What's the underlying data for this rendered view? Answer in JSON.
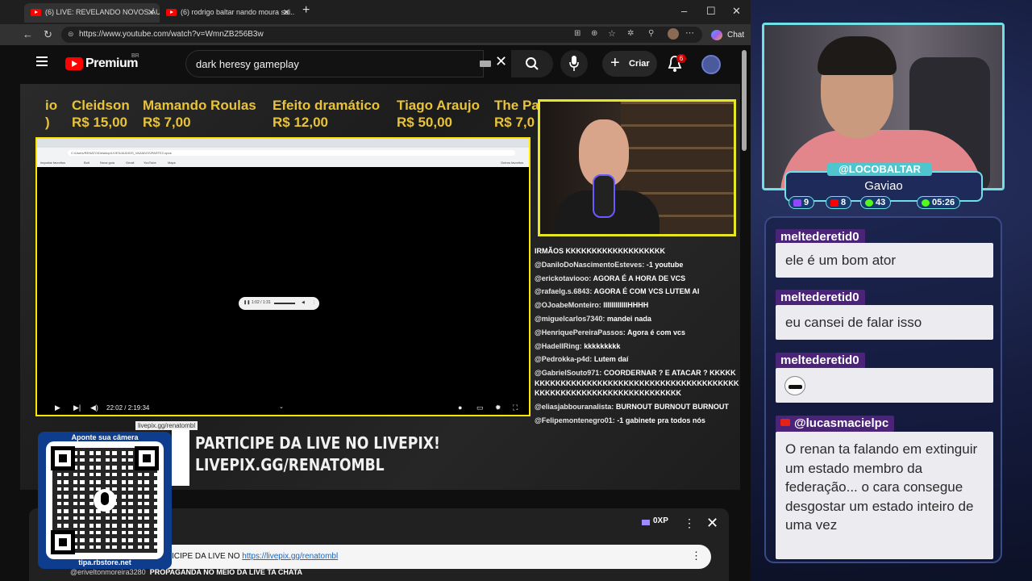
{
  "browser": {
    "tabs": [
      {
        "title": "(6) LIVE: REVELANDO NOVOS ÁUD...",
        "active": true
      },
      {
        "title": "(6) rodrigo baltar nando moura sei...",
        "active": false
      }
    ],
    "new_tab": "+",
    "url": "https://www.youtube.com/watch?v=WmnZB256B3w",
    "chat_button": "Chat",
    "window_controls": [
      "–",
      "☐",
      "✕"
    ]
  },
  "youtube": {
    "logo_text": "Premium",
    "region": "BR",
    "search_value": "dark heresy gameplay",
    "create_label": "Criar",
    "notification_count": "6"
  },
  "stream": {
    "ticker": [
      {
        "name": "io",
        "amount": ")"
      },
      {
        "name": "Cleidson",
        "amount": "R$ 15,00"
      },
      {
        "name": "Mamando Roulas",
        "amount": "R$ 7,00"
      },
      {
        "name": "Efeito dramático",
        "amount": "R$ 12,00"
      },
      {
        "name": "Tiago Araujo",
        "amount": "R$ 50,00"
      },
      {
        "name": "The Pa",
        "amount": "R$ 7,0"
      }
    ],
    "inner_url": "C:/Users/RENATO/Desktop/LIVES/AUDIOS_VAZADOS/PARTE2.opus",
    "inner_bookmarks": [
      "Importar favoritos",
      "Bolt",
      "Nova guia",
      "Gmail",
      "YouTube",
      "Maps",
      "Outros favoritos"
    ],
    "audio_time": "1:02 / 1:31",
    "video_time": "22:02 / 2:19:34",
    "chat_overlay": [
      {
        "user": "",
        "text": "IRMÃOS KKKKKKKKKKKKKKKKKKK"
      },
      {
        "user": "@DaniloDoNascimentoEsteves:",
        "text": "-1 youtube"
      },
      {
        "user": "@erickotaviooo:",
        "text": "AGORA É A HORA DE VCS"
      },
      {
        "user": "@rafaelg.s.6843:",
        "text": "AGORA É COM VCS LUTEM AI"
      },
      {
        "user": "@OJoabeMonteiro:",
        "text": "IIIIIIIIIIIIHHHH"
      },
      {
        "user": "@miguelcarlos7340:",
        "text": "mandei nada"
      },
      {
        "user": "@HenriquePereiraPassos:",
        "text": "Agora é com vcs"
      },
      {
        "user": "@HadellRing:",
        "text": "kkkkkkkkk"
      },
      {
        "user": "@Pedrokka-p4d:",
        "text": "Lutem daí"
      },
      {
        "user": "@GabrielSouto971:",
        "text": "COORDERNAR ? E ATACAR ? KKKKKKKKKKKKKKKKKKKKKKKKKKKKKKKKKKKKKKKKKKKKKKKKKKKKKKKKKKKKKKKKKKKKKKKK"
      },
      {
        "user": "@eliasjabbouranalista:",
        "text": "BURNOUT BURNOUT BURNOUT"
      },
      {
        "user": "@Felipemontenegro01:",
        "text": "-1 gabinete pra todos nós"
      }
    ],
    "livepix_line1": "PARTICIPE DA LIVE NO LIVEPIX!",
    "livepix_line2": "LIVEPIX.GG/RENATOMBL",
    "livepix_tag": "livepix.gg/renatombl",
    "qr_title": "Aponte sua câmera",
    "qr_footer": "tipa.rbstore.net"
  },
  "live_chat": {
    "xp": "0XP",
    "pinned_prefix": "ICIPE DA LIVE NO ",
    "pinned_link": "https://livepix.gg/renatombl",
    "bottom_user": "@eriveltonmoreira3280",
    "bottom_text": "PROPAGANDA NO MEIO DA LIVE TA CHATA"
  },
  "overlay": {
    "handle": "@LOCOBALTAR",
    "name": "Gaviao",
    "stats": [
      {
        "icon": "twitch-icon",
        "value": "9",
        "color": "#9146ff"
      },
      {
        "icon": "youtube-icon",
        "value": "8",
        "color": "#ff0000"
      },
      {
        "icon": "kick-icon",
        "value": "43",
        "color": "#53fc18"
      },
      {
        "icon": "clock-icon",
        "value": "05:26",
        "color": "#53fc18"
      }
    ],
    "messages": [
      {
        "user": "meltederetid0",
        "text": "ele é um bom ator"
      },
      {
        "user": "meltederetid0",
        "text": "eu cansei de falar isso"
      },
      {
        "user": "meltederetid0",
        "text": ""
      },
      {
        "user": "@lucasmacielpc",
        "text": "O renan ta falando em extinguir um estado membro da federação... o cara consegue desgostar um estado inteiro de uma vez"
      }
    ]
  }
}
